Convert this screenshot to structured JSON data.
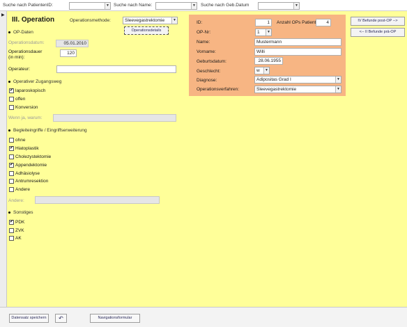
{
  "search": {
    "patient_id_label": "Suche nach PatientenID:",
    "name_label": "Suche nach Name:",
    "geb_label": "Suche nach Geb.Datum",
    "patient_id_value": "",
    "name_value": "",
    "geb_value": ""
  },
  "form": {
    "title": "III. Operation",
    "methode_label": "Operationsmethode:",
    "methode_value": "Sleevegastrektomie",
    "details_button": "Operationsdetails",
    "op_daten": {
      "section_label": "OP-Daten",
      "datum_label": "Operationsdatum:",
      "datum_value": "05.01.2010",
      "dauer_label": "Operationsdauer",
      "dauer_label2": "(in min):",
      "dauer_value": "120",
      "operateur_label": "Operateur:",
      "operateur_value": ""
    },
    "zugang": {
      "section_label": "Operativer Zugangsweg",
      "options": [
        {
          "label": "laparoskopisch",
          "checked": true
        },
        {
          "label": "offen",
          "checked": false
        },
        {
          "label": "Konversion",
          "checked": false
        }
      ],
      "wenn_label": "Wenn ja, warum:",
      "wenn_value": ""
    },
    "begleit": {
      "section_label": "Begleiteingriffe / Eingriffserweiterung",
      "options": [
        {
          "label": "ohne",
          "checked": false
        },
        {
          "label": "Hiatoplastik",
          "checked": true
        },
        {
          "label": "Cholezystektomie",
          "checked": false
        },
        {
          "label": "Appendektomie",
          "checked": true
        },
        {
          "label": "Adhäsiolyse",
          "checked": false
        },
        {
          "label": "Antrumresektion",
          "checked": false
        },
        {
          "label": "Andere",
          "checked": false
        }
      ],
      "andere_label": "Andere:",
      "andere_value": ""
    },
    "sonstiges": {
      "section_label": "Sonstiges",
      "options": [
        {
          "label": "PDK",
          "checked": true
        },
        {
          "label": "ZVK",
          "checked": false
        },
        {
          "label": "AK",
          "checked": false
        }
      ]
    }
  },
  "patient": {
    "id_label": "ID:",
    "id_value": "1",
    "anzahl_label": "Anzahl OPs Patient:",
    "anzahl_value": "4",
    "opnr_label": "OP-Nr:",
    "opnr_value": "1",
    "name_label": "Name:",
    "name_value": "Mustermann",
    "vorname_label": "Vorname:",
    "vorname_value": "Willi",
    "geb_label": "Geburtsdatum:",
    "geb_value": "28.06.1955",
    "geschlecht_label": "Geschlecht:",
    "geschlecht_value": "w",
    "diagnose_label": "Diagnose:",
    "diagnose_value": "Adipositas Grad I",
    "verfahren_label": "Operationsverfahren:",
    "verfahren_value": "Sleevegastrektomie"
  },
  "nav": {
    "next": "IV Befunde post-OP -->",
    "prev": "<-- II Befunde prä-OP"
  },
  "footer": {
    "save_button": "Datensatz speichern",
    "undo_button": "↶",
    "nav_button": "Navigationsformular"
  },
  "glyphs": {
    "arrow": "▼",
    "check": "✔",
    "record_pointer": "▶"
  },
  "colors": {
    "detail_bg": "#ffff99",
    "patient_panel_bg": "#f7b583"
  }
}
